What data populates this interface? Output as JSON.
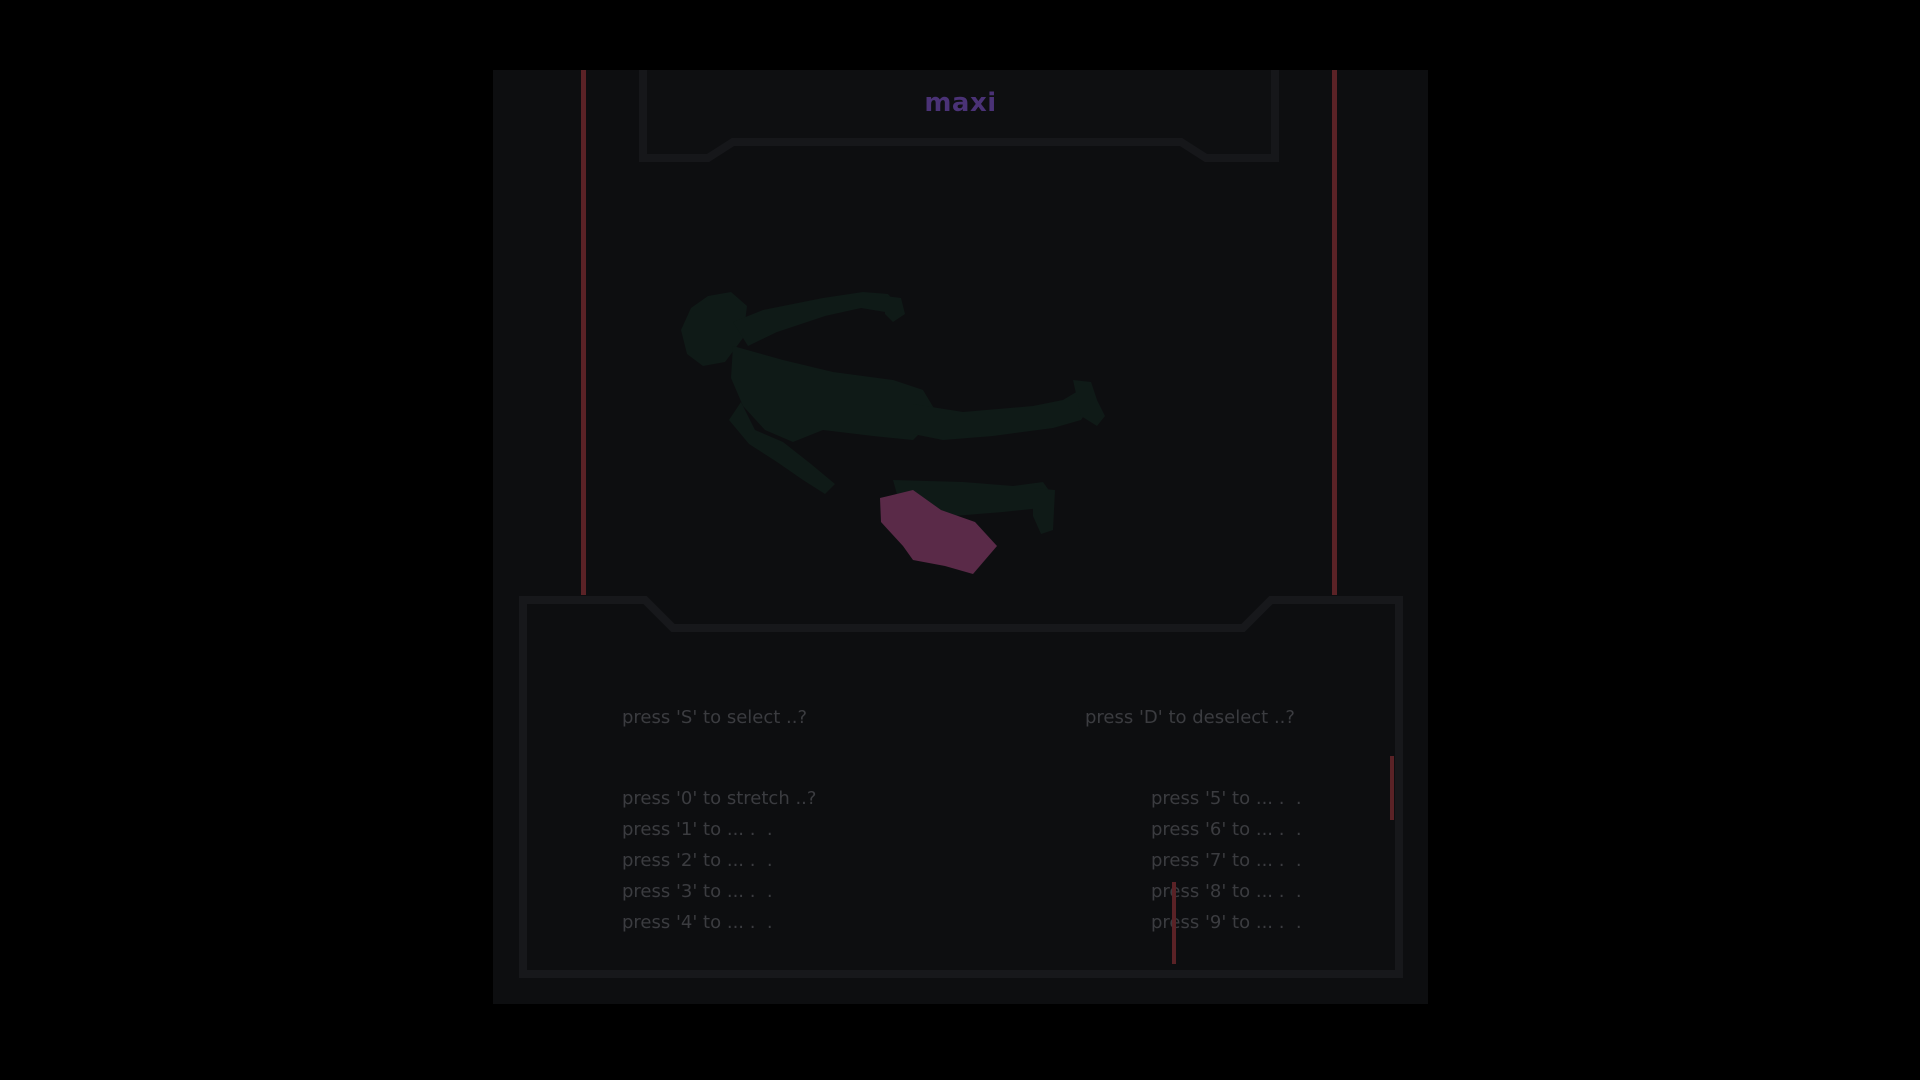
{
  "title": "maxi",
  "controls": {
    "select": "press 'S' to select ..?",
    "deselect": "press 'D' to deselect ..?",
    "left": [
      "press '0' to stretch ..?",
      "press '1' to ... .  .",
      "press '2' to ... .  .",
      "press '3' to ... .  .",
      "press '4' to ... .  ."
    ],
    "right": [
      "press '5' to ... .  .",
      "press '6' to ... .  .",
      "press '7' to ... .  .",
      "press '8' to ... .  .",
      "press '9' to ... .  ."
    ]
  },
  "colors": {
    "background": "#000000",
    "panel": "#0d0e10",
    "frame": "#16171a",
    "accent_red": "#5a2226",
    "title": "#4a3276",
    "body_silhouette": "#0f1a17",
    "selected_part": "#5a2a48",
    "text": "#3b3c40"
  }
}
